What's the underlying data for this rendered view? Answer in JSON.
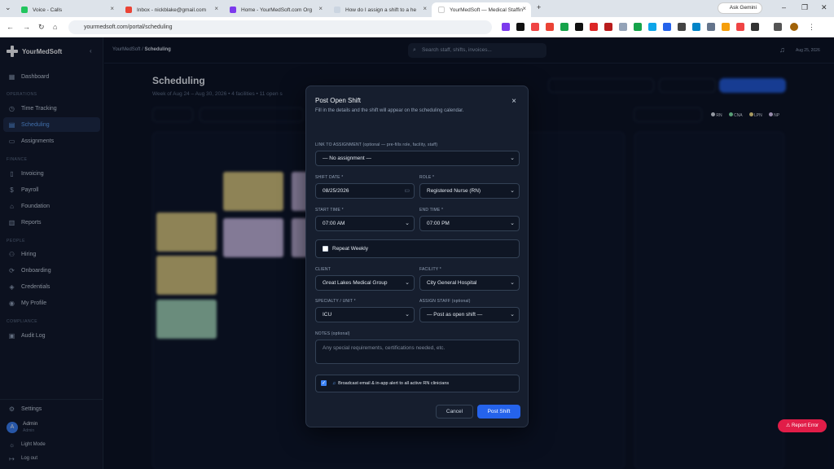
{
  "browser": {
    "tabs": [
      {
        "label": "Voice - Calls",
        "color": "#22c55e"
      },
      {
        "label": "Inbox - nickblake@gmail.com",
        "color": "#ea4335"
      },
      {
        "label": "Home - YourMedSoft.com Org",
        "color": "#7c3aed"
      },
      {
        "label": "How do I assign a shift to a he",
        "color": "#9ca3af"
      },
      {
        "label": "YourMedSoft — Medical Staffin",
        "color": "#ffffff"
      }
    ],
    "url": "yourmedsoft.com/portal/scheduling",
    "gemini": "Ask Gemini"
  },
  "sidebar": {
    "brand": "YourMedSoft",
    "sections": {
      "operations": "OPERATIONS",
      "finance": "FINANCE",
      "people": "PEOPLE",
      "compliance": "COMPLIANCE"
    },
    "items": [
      {
        "label": "Dashboard",
        "icon": "grid-icon"
      },
      {
        "label": "Time Tracking",
        "icon": "clock-icon"
      },
      {
        "label": "Scheduling",
        "icon": "calendar-icon"
      },
      {
        "label": "Assignments",
        "icon": "briefcase-icon"
      },
      {
        "label": "Invoicing",
        "icon": "invoice-icon"
      },
      {
        "label": "Payroll",
        "icon": "dollar-icon"
      },
      {
        "label": "Foundation",
        "icon": "bank-icon"
      },
      {
        "label": "Reports",
        "icon": "chart-icon"
      },
      {
        "label": "Hiring",
        "icon": "user-plus-icon"
      },
      {
        "label": "Onboarding",
        "icon": "onboard-icon"
      },
      {
        "label": "Credentials",
        "icon": "shield-icon"
      },
      {
        "label": "My Profile",
        "icon": "user-icon"
      },
      {
        "label": "Audit Log",
        "icon": "clipboard-icon"
      }
    ],
    "settings": "Settings",
    "user": {
      "initial": "A",
      "name": "Admin",
      "role": "Admin"
    },
    "light_mode": "Light Mode",
    "logout": "Log out"
  },
  "topbar": {
    "crumb_root": "YourMedSoft",
    "crumb_sep": "/",
    "crumb_current": "Scheduling",
    "search_placeholder": "Search staff, shifts, invoices...",
    "date": "Aug 25, 2026"
  },
  "page": {
    "title": "Scheduling",
    "subtitle": "Week of Aug 24 – Aug 30, 2026 • 4 facilities • 11 open s",
    "legend": [
      "RN",
      "CNA",
      "LPN",
      "NP"
    ]
  },
  "modal": {
    "title": "Post Open Shift",
    "subtitle": "Fill in the details and the shift will appear on the scheduling calendar.",
    "link_label": "LINK TO ASSIGNMENT (optional — pre-fills role, facility, staff)",
    "link_value": "— No assignment —",
    "date_label": "SHIFT DATE *",
    "date_value": "08/25/2026",
    "role_label": "ROLE *",
    "role_value": "Registered Nurse (RN)",
    "start_label": "START TIME *",
    "start_value": "07:00 AM",
    "end_label": "END TIME *",
    "end_value": "07:00 PM",
    "repeat_label": "Repeat Weekly",
    "client_label": "CLIENT",
    "client_value": "Great Lakes Medical Group",
    "facility_label": "FACILITY *",
    "facility_value": "City General Hospital",
    "specialty_label": "SPECIALTY / UNIT *",
    "specialty_value": "ICU",
    "assign_label": "ASSIGN STAFF (optional)",
    "assign_value": "— Post as open shift —",
    "notes_label": "NOTES (optional)",
    "notes_placeholder": "Any special requirements, certifications needed, etc.",
    "broadcast_label": "Broadcast email & in-app alert to all active RN clinicians",
    "cancel": "Cancel",
    "post": "Post Shift"
  },
  "report_error": "Report Error"
}
